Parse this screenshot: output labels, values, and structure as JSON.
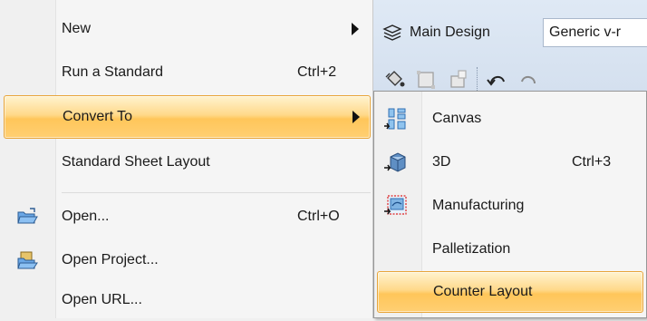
{
  "main_menu": {
    "items": [
      {
        "label": "New",
        "shortcut": "",
        "has_submenu": true
      },
      {
        "label": "Run a Standard",
        "shortcut": "Ctrl+2",
        "has_submenu": false
      },
      {
        "label": "Convert To",
        "shortcut": "",
        "has_submenu": true,
        "highlighted": true
      },
      {
        "label": "Standard Sheet Layout",
        "shortcut": "",
        "has_submenu": false
      },
      {
        "label": "Open...",
        "shortcut": "Ctrl+O",
        "has_submenu": false,
        "icon": "open-folder-icon"
      },
      {
        "label": "Open Project...",
        "shortcut": "",
        "has_submenu": false,
        "icon": "open-project-icon"
      },
      {
        "label": "Open URL...",
        "shortcut": "",
        "has_submenu": false
      }
    ]
  },
  "toolbar": {
    "design_label": "Main Design",
    "view_select": "Generic v-r"
  },
  "submenu": {
    "items": [
      {
        "label": "Canvas",
        "shortcut": "",
        "icon": "canvas-icon"
      },
      {
        "label": "3D",
        "shortcut": "Ctrl+3",
        "icon": "3d-box-icon"
      },
      {
        "label": "Manufacturing",
        "shortcut": "",
        "icon": "manufacturing-icon"
      },
      {
        "label": "Palletization",
        "shortcut": ""
      },
      {
        "label": "Counter Layout",
        "shortcut": "",
        "highlighted": true
      }
    ]
  },
  "colors": {
    "highlight": "#ffd98a",
    "highlight_border": "#e8a53a",
    "toolbar_bg": "#d3dfee"
  }
}
